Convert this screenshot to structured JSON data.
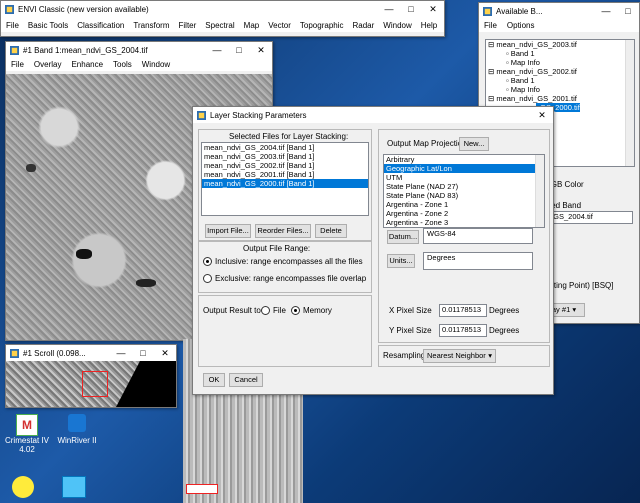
{
  "envi": {
    "title": "ENVI Classic (new version available)",
    "menu": [
      "File",
      "Basic Tools",
      "Classification",
      "Transform",
      "Filter",
      "Spectral",
      "Map",
      "Vector",
      "Topographic",
      "Radar",
      "Window",
      "Help"
    ]
  },
  "band_window": {
    "title": "#1 Band 1:mean_ndvi_GS_2004.tif",
    "menu": [
      "File",
      "Overlay",
      "Enhance",
      "Tools",
      "Window"
    ]
  },
  "scroll_window": {
    "title": "#1 Scroll (0.098..."
  },
  "available_bands": {
    "title": "Available B...",
    "menu": [
      "File",
      "Options"
    ],
    "tree": [
      {
        "label": "mean_ndvi_GS_2003.tif",
        "level": 0
      },
      {
        "label": "Band 1",
        "level": 1
      },
      {
        "label": "Map Info",
        "level": 1
      },
      {
        "label": "mean_ndvi_GS_2002.tif",
        "level": 0
      },
      {
        "label": "Band 1",
        "level": 1
      },
      {
        "label": "Map Info",
        "level": 1
      },
      {
        "label": "mean_ndvi_GS_2001.tif",
        "level": 0
      }
    ],
    "partial_selected": "_GS_2000.tif",
    "rgb_label": "RGB Color",
    "selected_band_label": "cted Band",
    "selected_band_value": "_GS_2004.tif",
    "bsq_label": "eating Point) [BSQ]",
    "display_btn": "ay #1 ▾"
  },
  "dialog": {
    "title": "Layer Stacking Parameters",
    "files_label": "Selected Files for Layer Stacking:",
    "files": [
      "mean_ndvi_GS_2004.tif [Band 1]",
      "mean_ndvi_GS_2003.tif [Band 1]",
      "mean_ndvi_GS_2002.tif [Band 1]",
      "mean_ndvi_GS_2001.tif [Band 1]",
      "mean_ndvi_GS_2000.tif [Band 1]"
    ],
    "import_btn": "Import File...",
    "reorder_btn": "Reorder Files...",
    "delete_btn": "Delete",
    "range_label": "Output File Range:",
    "inclusive": "Inclusive: range encompasses all the files",
    "exclusive": "Exclusive: range encompasses file overlap",
    "output_result_label": "Output Result to",
    "file_opt": "File",
    "memory_opt": "Memory",
    "ok_btn": "OK",
    "cancel_btn": "Cancel",
    "projection_label": "Output Map Projection",
    "new_btn": "New...",
    "projections": [
      "Arbitrary",
      "Geographic Lat/Lon",
      "UTM",
      "State Plane (NAD 27)",
      "State Plane (NAD 83)",
      "Argentina - Zone 1",
      "Argentina - Zone 2",
      "Argentina - Zone 3"
    ],
    "datum_btn": "Datum...",
    "datum_value": "WGS-84",
    "units_btn": "Units...",
    "units_value": "Degrees",
    "x_pixel_label": "X Pixel Size",
    "x_pixel_value": "0.01178513",
    "x_unit": "Degrees",
    "y_pixel_label": "Y Pixel Size",
    "y_pixel_value": "0.01178513",
    "y_unit": "Degrees",
    "resampling_label": "Resampling",
    "resampling_value": "Nearest Neighbor"
  },
  "desktop": {
    "icon1": "Crimestat IV 4.02",
    "icon2": "WinRiver II"
  }
}
